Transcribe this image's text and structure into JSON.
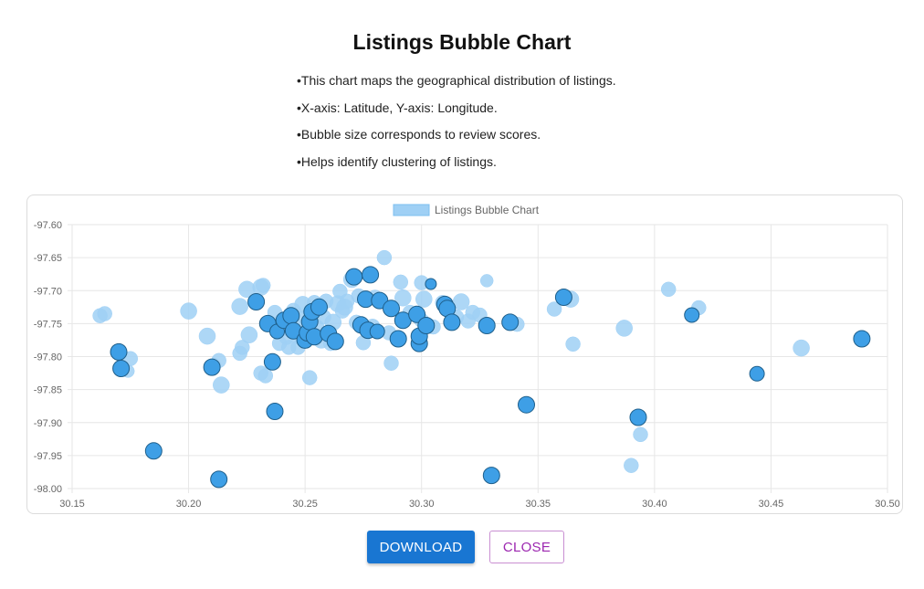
{
  "page": {
    "title": "Listings Bubble Chart",
    "description": [
      "This chart maps the geographical distribution of listings.",
      "X-axis: Latitude, Y-axis: Longitude.",
      "Bubble size corresponds to review scores.",
      "Helps identify clustering of listings."
    ]
  },
  "buttons": {
    "download": "DOWNLOAD",
    "close": "CLOSE"
  },
  "colors": {
    "bubble_fill_light": "#9fd0f5",
    "bubble_fill_dark": "#3e9fe6",
    "bubble_stroke_dark": "#1f5f8b",
    "legend_fill": "#9fd0f5",
    "grid": "#e6e6e6",
    "tick_text": "#666666",
    "download_button": "#1976d2",
    "close_button_text": "#9c27b0"
  },
  "chart_data": {
    "type": "scatter",
    "legend": {
      "label": "Listings Bubble Chart",
      "position": "top-center"
    },
    "xlim": [
      30.15,
      30.5
    ],
    "ylim": [
      -98.0,
      -97.6
    ],
    "xticks": [
      "30.15",
      "30.20",
      "30.25",
      "30.30",
      "30.35",
      "30.40",
      "30.45",
      "30.50"
    ],
    "yticks": [
      "-97.60",
      "-97.65",
      "-97.70",
      "-97.75",
      "-97.80",
      "-97.85",
      "-97.90",
      "-97.95",
      "-98.00"
    ],
    "grid": true,
    "points": [
      {
        "x": 30.162,
        "y": -97.738,
        "r": 8,
        "style": "light"
      },
      {
        "x": 30.164,
        "y": -97.735,
        "r": 8,
        "style": "light"
      },
      {
        "x": 30.17,
        "y": -97.793,
        "r": 9,
        "style": "dark"
      },
      {
        "x": 30.171,
        "y": -97.818,
        "r": 9,
        "style": "dark"
      },
      {
        "x": 30.174,
        "y": -97.822,
        "r": 7,
        "style": "light"
      },
      {
        "x": 30.175,
        "y": -97.803,
        "r": 8,
        "style": "light"
      },
      {
        "x": 30.185,
        "y": -97.943,
        "r": 9,
        "style": "dark"
      },
      {
        "x": 30.2,
        "y": -97.731,
        "r": 9,
        "style": "light"
      },
      {
        "x": 30.208,
        "y": -97.769,
        "r": 9,
        "style": "light"
      },
      {
        "x": 30.21,
        "y": -97.816,
        "r": 9,
        "style": "dark"
      },
      {
        "x": 30.211,
        "y": -97.812,
        "r": 7,
        "style": "light"
      },
      {
        "x": 30.213,
        "y": -97.986,
        "r": 9,
        "style": "dark"
      },
      {
        "x": 30.213,
        "y": -97.806,
        "r": 8,
        "style": "light"
      },
      {
        "x": 30.214,
        "y": -97.843,
        "r": 9,
        "style": "light"
      },
      {
        "x": 30.222,
        "y": -97.724,
        "r": 9,
        "style": "light"
      },
      {
        "x": 30.222,
        "y": -97.795,
        "r": 8,
        "style": "light"
      },
      {
        "x": 30.223,
        "y": -97.786,
        "r": 8,
        "style": "light"
      },
      {
        "x": 30.225,
        "y": -97.698,
        "r": 9,
        "style": "light"
      },
      {
        "x": 30.226,
        "y": -97.767,
        "r": 9,
        "style": "light"
      },
      {
        "x": 30.229,
        "y": -97.717,
        "r": 9,
        "style": "dark"
      },
      {
        "x": 30.231,
        "y": -97.695,
        "r": 9,
        "style": "light"
      },
      {
        "x": 30.231,
        "y": -97.825,
        "r": 8,
        "style": "light"
      },
      {
        "x": 30.232,
        "y": -97.692,
        "r": 8,
        "style": "light"
      },
      {
        "x": 30.233,
        "y": -97.829,
        "r": 8,
        "style": "light"
      },
      {
        "x": 30.234,
        "y": -97.75,
        "r": 9,
        "style": "dark"
      },
      {
        "x": 30.236,
        "y": -97.808,
        "r": 9,
        "style": "dark"
      },
      {
        "x": 30.237,
        "y": -97.883,
        "r": 9,
        "style": "dark"
      },
      {
        "x": 30.237,
        "y": -97.733,
        "r": 8,
        "style": "light"
      },
      {
        "x": 30.238,
        "y": -97.762,
        "r": 8,
        "style": "dark"
      },
      {
        "x": 30.239,
        "y": -97.78,
        "r": 8,
        "style": "light"
      },
      {
        "x": 30.24,
        "y": -97.757,
        "r": 9,
        "style": "light"
      },
      {
        "x": 30.241,
        "y": -97.745,
        "r": 9,
        "style": "dark"
      },
      {
        "x": 30.242,
        "y": -97.771,
        "r": 8,
        "style": "light"
      },
      {
        "x": 30.243,
        "y": -97.786,
        "r": 8,
        "style": "light"
      },
      {
        "x": 30.244,
        "y": -97.738,
        "r": 9,
        "style": "dark"
      },
      {
        "x": 30.245,
        "y": -97.761,
        "r": 9,
        "style": "dark"
      },
      {
        "x": 30.245,
        "y": -97.73,
        "r": 8,
        "style": "light"
      },
      {
        "x": 30.246,
        "y": -97.752,
        "r": 8,
        "style": "light"
      },
      {
        "x": 30.247,
        "y": -97.786,
        "r": 8,
        "style": "light"
      },
      {
        "x": 30.248,
        "y": -97.77,
        "r": 9,
        "style": "light"
      },
      {
        "x": 30.249,
        "y": -97.721,
        "r": 9,
        "style": "light"
      },
      {
        "x": 30.25,
        "y": -97.775,
        "r": 9,
        "style": "dark"
      },
      {
        "x": 30.25,
        "y": -97.741,
        "r": 8,
        "style": "light"
      },
      {
        "x": 30.251,
        "y": -97.764,
        "r": 9,
        "style": "dark"
      },
      {
        "x": 30.252,
        "y": -97.747,
        "r": 9,
        "style": "dark"
      },
      {
        "x": 30.252,
        "y": -97.832,
        "r": 8,
        "style": "light"
      },
      {
        "x": 30.253,
        "y": -97.732,
        "r": 9,
        "style": "dark"
      },
      {
        "x": 30.254,
        "y": -97.718,
        "r": 8,
        "style": "light"
      },
      {
        "x": 30.254,
        "y": -97.77,
        "r": 9,
        "style": "dark"
      },
      {
        "x": 30.255,
        "y": -97.755,
        "r": 8,
        "style": "light"
      },
      {
        "x": 30.256,
        "y": -97.725,
        "r": 9,
        "style": "dark"
      },
      {
        "x": 30.257,
        "y": -97.775,
        "r": 9,
        "style": "light"
      },
      {
        "x": 30.258,
        "y": -97.74,
        "r": 8,
        "style": "light"
      },
      {
        "x": 30.259,
        "y": -97.716,
        "r": 8,
        "style": "light"
      },
      {
        "x": 30.26,
        "y": -97.765,
        "r": 9,
        "style": "dark"
      },
      {
        "x": 30.261,
        "y": -97.78,
        "r": 8,
        "style": "light"
      },
      {
        "x": 30.262,
        "y": -97.748,
        "r": 9,
        "style": "light"
      },
      {
        "x": 30.263,
        "y": -97.777,
        "r": 9,
        "style": "dark"
      },
      {
        "x": 30.264,
        "y": -97.72,
        "r": 9,
        "style": "light"
      },
      {
        "x": 30.265,
        "y": -97.701,
        "r": 8,
        "style": "light"
      },
      {
        "x": 30.266,
        "y": -97.731,
        "r": 8,
        "style": "light"
      },
      {
        "x": 30.267,
        "y": -97.725,
        "r": 9,
        "style": "light"
      },
      {
        "x": 30.268,
        "y": -97.716,
        "r": 8,
        "style": "light"
      },
      {
        "x": 30.27,
        "y": -97.683,
        "r": 9,
        "style": "light"
      },
      {
        "x": 30.271,
        "y": -97.679,
        "r": 9,
        "style": "dark"
      },
      {
        "x": 30.272,
        "y": -97.748,
        "r": 8,
        "style": "light"
      },
      {
        "x": 30.273,
        "y": -97.708,
        "r": 8,
        "style": "light"
      },
      {
        "x": 30.274,
        "y": -97.752,
        "r": 9,
        "style": "dark"
      },
      {
        "x": 30.275,
        "y": -97.779,
        "r": 8,
        "style": "light"
      },
      {
        "x": 30.276,
        "y": -97.713,
        "r": 9,
        "style": "dark"
      },
      {
        "x": 30.277,
        "y": -97.76,
        "r": 9,
        "style": "dark"
      },
      {
        "x": 30.278,
        "y": -97.676,
        "r": 9,
        "style": "dark"
      },
      {
        "x": 30.279,
        "y": -97.754,
        "r": 8,
        "style": "light"
      },
      {
        "x": 30.28,
        "y": -97.71,
        "r": 8,
        "style": "light"
      },
      {
        "x": 30.281,
        "y": -97.762,
        "r": 8,
        "style": "dark"
      },
      {
        "x": 30.282,
        "y": -97.715,
        "r": 9,
        "style": "dark"
      },
      {
        "x": 30.284,
        "y": -97.65,
        "r": 8,
        "style": "light"
      },
      {
        "x": 30.286,
        "y": -97.764,
        "r": 8,
        "style": "light"
      },
      {
        "x": 30.287,
        "y": -97.727,
        "r": 9,
        "style": "dark"
      },
      {
        "x": 30.287,
        "y": -97.81,
        "r": 8,
        "style": "light"
      },
      {
        "x": 30.29,
        "y": -97.773,
        "r": 9,
        "style": "dark"
      },
      {
        "x": 30.291,
        "y": -97.687,
        "r": 8,
        "style": "light"
      },
      {
        "x": 30.292,
        "y": -97.711,
        "r": 9,
        "style": "light"
      },
      {
        "x": 30.292,
        "y": -97.745,
        "r": 9,
        "style": "dark"
      },
      {
        "x": 30.295,
        "y": -97.733,
        "r": 8,
        "style": "light"
      },
      {
        "x": 30.298,
        "y": -97.736,
        "r": 9,
        "style": "dark"
      },
      {
        "x": 30.299,
        "y": -97.78,
        "r": 9,
        "style": "dark"
      },
      {
        "x": 30.299,
        "y": -97.769,
        "r": 9,
        "style": "dark"
      },
      {
        "x": 30.3,
        "y": -97.745,
        "r": 8,
        "style": "light"
      },
      {
        "x": 30.3,
        "y": -97.688,
        "r": 8,
        "style": "light"
      },
      {
        "x": 30.301,
        "y": -97.713,
        "r": 9,
        "style": "light"
      },
      {
        "x": 30.302,
        "y": -97.753,
        "r": 9,
        "style": "dark"
      },
      {
        "x": 30.304,
        "y": -97.69,
        "r": 6,
        "style": "dark"
      },
      {
        "x": 30.305,
        "y": -97.755,
        "r": 8,
        "style": "light"
      },
      {
        "x": 30.309,
        "y": -97.718,
        "r": 8,
        "style": "light"
      },
      {
        "x": 30.31,
        "y": -97.721,
        "r": 9,
        "style": "dark"
      },
      {
        "x": 30.311,
        "y": -97.727,
        "r": 9,
        "style": "dark"
      },
      {
        "x": 30.313,
        "y": -97.748,
        "r": 9,
        "style": "dark"
      },
      {
        "x": 30.315,
        "y": -97.74,
        "r": 8,
        "style": "light"
      },
      {
        "x": 30.317,
        "y": -97.717,
        "r": 9,
        "style": "light"
      },
      {
        "x": 30.32,
        "y": -97.746,
        "r": 8,
        "style": "light"
      },
      {
        "x": 30.322,
        "y": -97.733,
        "r": 8,
        "style": "light"
      },
      {
        "x": 30.325,
        "y": -97.737,
        "r": 8,
        "style": "light"
      },
      {
        "x": 30.328,
        "y": -97.685,
        "r": 7,
        "style": "light"
      },
      {
        "x": 30.328,
        "y": -97.753,
        "r": 9,
        "style": "dark"
      },
      {
        "x": 30.33,
        "y": -97.98,
        "r": 9,
        "style": "dark"
      },
      {
        "x": 30.338,
        "y": -97.748,
        "r": 9,
        "style": "dark"
      },
      {
        "x": 30.341,
        "y": -97.751,
        "r": 8,
        "style": "light"
      },
      {
        "x": 30.345,
        "y": -97.873,
        "r": 9,
        "style": "dark"
      },
      {
        "x": 30.357,
        "y": -97.728,
        "r": 8,
        "style": "light"
      },
      {
        "x": 30.361,
        "y": -97.71,
        "r": 9,
        "style": "dark"
      },
      {
        "x": 30.364,
        "y": -97.713,
        "r": 9,
        "style": "light"
      },
      {
        "x": 30.365,
        "y": -97.781,
        "r": 8,
        "style": "light"
      },
      {
        "x": 30.387,
        "y": -97.757,
        "r": 9,
        "style": "light"
      },
      {
        "x": 30.39,
        "y": -97.965,
        "r": 8,
        "style": "light"
      },
      {
        "x": 30.393,
        "y": -97.892,
        "r": 9,
        "style": "dark"
      },
      {
        "x": 30.394,
        "y": -97.918,
        "r": 8,
        "style": "light"
      },
      {
        "x": 30.406,
        "y": -97.698,
        "r": 8,
        "style": "light"
      },
      {
        "x": 30.416,
        "y": -97.737,
        "r": 8,
        "style": "dark"
      },
      {
        "x": 30.419,
        "y": -97.726,
        "r": 8,
        "style": "light"
      },
      {
        "x": 30.444,
        "y": -97.826,
        "r": 8,
        "style": "dark"
      },
      {
        "x": 30.463,
        "y": -97.787,
        "r": 9,
        "style": "light"
      },
      {
        "x": 30.489,
        "y": -97.773,
        "r": 9,
        "style": "dark"
      }
    ]
  }
}
